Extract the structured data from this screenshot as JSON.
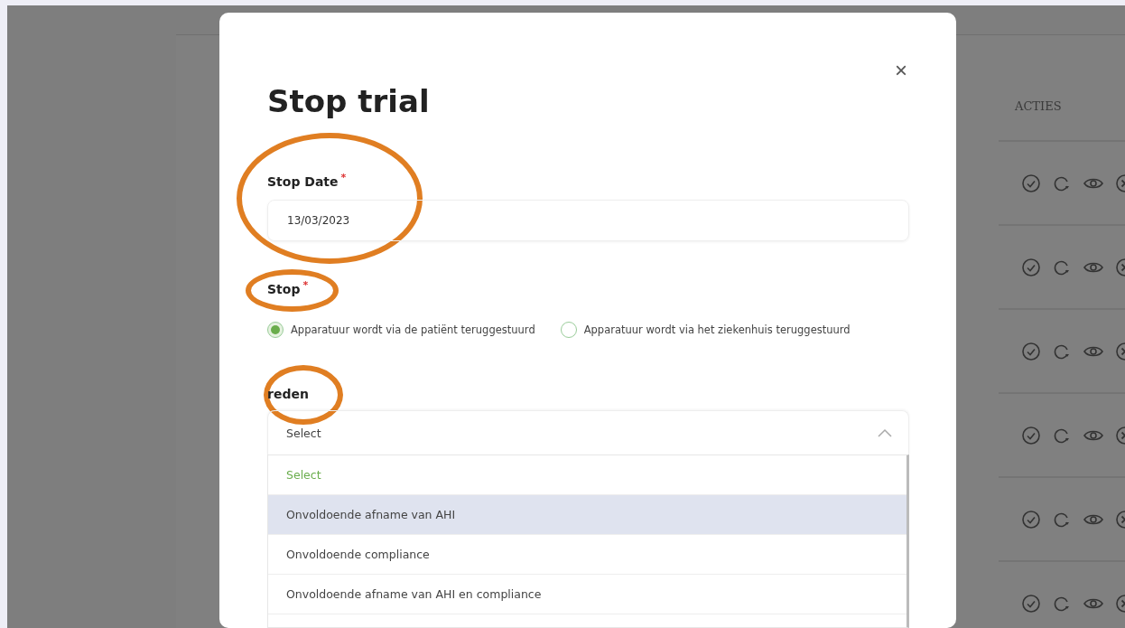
{
  "table": {
    "columns": [
      "ACTIES"
    ]
  },
  "modal": {
    "title": "Stop trial",
    "close": "×",
    "stop_date": {
      "label": "Stop Date",
      "required_mark": "*",
      "value": "13/03/2023"
    },
    "stop": {
      "label": "Stop",
      "required_mark": "*",
      "options": [
        {
          "label": "Apparatuur wordt via de patiënt teruggestuurd",
          "selected": true
        },
        {
          "label": "Apparatuur wordt via het ziekenhuis teruggestuurd",
          "selected": false
        }
      ]
    },
    "reden": {
      "label": "reden",
      "value": "Select",
      "expanded": true,
      "options": [
        {
          "label": "Select",
          "selected": true,
          "hovered": false
        },
        {
          "label": "Onvoldoende afname van AHI",
          "selected": false,
          "hovered": true
        },
        {
          "label": "Onvoldoende compliance",
          "selected": false,
          "hovered": false
        },
        {
          "label": "Onvoldoende afname van AHI en compliance",
          "selected": false,
          "hovered": false
        }
      ]
    }
  }
}
